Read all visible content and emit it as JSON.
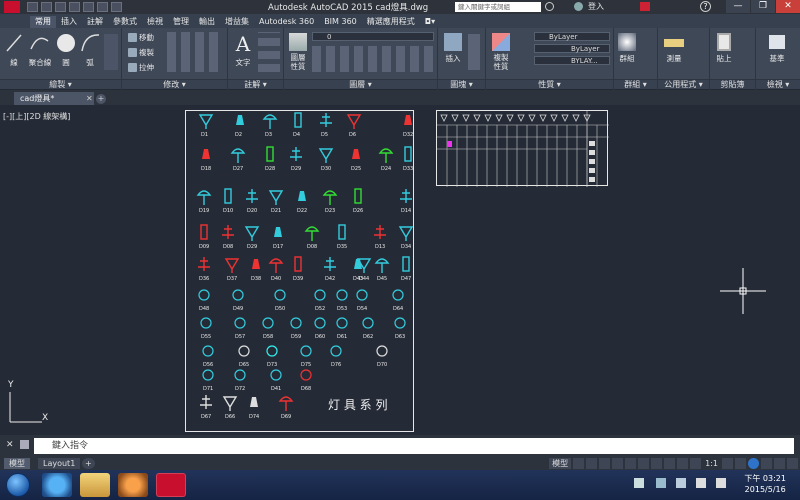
{
  "window": {
    "title": "Autodesk AutoCAD 2015   cad燈具.dwg",
    "search_placeholder": "鍵入關鍵字或詞組",
    "login": "登入",
    "controls": [
      "—",
      "❐",
      "✕"
    ]
  },
  "menu_tabs": [
    "常用",
    "插入",
    "註解",
    "參數式",
    "檢視",
    "管理",
    "輸出",
    "增益集",
    "Autodesk 360",
    "BIM 360",
    "精選應用程式",
    "◘▾"
  ],
  "ribbon": {
    "draw": {
      "label": "繪製 ▾",
      "line": "線",
      "polyline": "聚合線",
      "circle": "圓",
      "arc": "弧"
    },
    "modify": {
      "label": "修改 ▾",
      "move": "移動",
      "copy": "複製",
      "stretch": "拉伸"
    },
    "annotation": {
      "label": "註解 ▾",
      "text": "文字"
    },
    "layers": {
      "label": "圖層 ▾",
      "layer_props": "圖層\n性質",
      "current_layer": "0"
    },
    "block": {
      "label": "圖塊 ▾",
      "insert": "插入"
    },
    "properties": {
      "label": "性質 ▾",
      "match": "複製\n性質",
      "color": "ByLayer",
      "linetype": "ByLayer",
      "lineweight": "BYLAY..."
    },
    "groups": {
      "label": "群組 ▾",
      "group": "群組"
    },
    "utilities": {
      "label": "公用程式 ▾",
      "measure": "測量"
    },
    "clipboard": {
      "label": "剪貼簿",
      "paste": "貼上"
    },
    "view": {
      "label": "檢視 ▾",
      "base": "基準"
    }
  },
  "doc_tab": "cad燈具*",
  "viewport_label": "[-][上][2D 線架構]",
  "ucs": {
    "x": "X",
    "y": "Y"
  },
  "command": {
    "placeholder": "鍵入指令"
  },
  "layout_tabs": [
    "模型",
    "Layout1"
  ],
  "status": {
    "model": "模型",
    "scale": "1:1"
  },
  "taskbar": {
    "time": "下午 03:21",
    "date": "2015/5/16"
  },
  "drawing": {
    "title": "灯 具 系 列",
    "labels": [
      {
        "t": "D1"
      },
      {
        "t": "D2"
      },
      {
        "t": "D3"
      },
      {
        "t": "D4"
      },
      {
        "t": "D5"
      },
      {
        "t": "D6"
      },
      {
        "t": "D32"
      },
      {
        "t": "D18"
      },
      {
        "t": "D27"
      },
      {
        "t": "D28"
      },
      {
        "t": "D29"
      },
      {
        "t": "D30"
      },
      {
        "t": "D25"
      },
      {
        "t": "D24"
      },
      {
        "t": "D33"
      },
      {
        "t": "D19"
      },
      {
        "t": "D10"
      },
      {
        "t": "D20"
      },
      {
        "t": "D21"
      },
      {
        "t": "D22"
      },
      {
        "t": "D23"
      },
      {
        "t": "D26"
      },
      {
        "t": "D14"
      },
      {
        "t": "D09"
      },
      {
        "t": "D08"
      },
      {
        "t": "D29"
      },
      {
        "t": "D17"
      },
      {
        "t": "D08"
      },
      {
        "t": "D35"
      },
      {
        "t": "D13"
      },
      {
        "t": "D34"
      },
      {
        "t": "D36"
      },
      {
        "t": "D37"
      },
      {
        "t": "D38"
      },
      {
        "t": "D40"
      },
      {
        "t": "D39"
      },
      {
        "t": "D42"
      },
      {
        "t": "D44"
      },
      {
        "t": "D43"
      },
      {
        "t": "D45"
      },
      {
        "t": "D47"
      },
      {
        "t": "D48"
      },
      {
        "t": "D49"
      },
      {
        "t": "D50"
      },
      {
        "t": "D52"
      },
      {
        "t": "D53"
      },
      {
        "t": "D54"
      },
      {
        "t": "D64"
      },
      {
        "t": "D55"
      },
      {
        "t": "D57"
      },
      {
        "t": "D58"
      },
      {
        "t": "D59"
      },
      {
        "t": "D60"
      },
      {
        "t": "D61"
      },
      {
        "t": "D62"
      },
      {
        "t": "D63"
      },
      {
        "t": "D56"
      },
      {
        "t": "D65"
      },
      {
        "t": "D73"
      },
      {
        "t": "D75"
      },
      {
        "t": "D76"
      },
      {
        "t": "D70"
      },
      {
        "t": "D71"
      },
      {
        "t": "D72"
      },
      {
        "t": "D41"
      },
      {
        "t": "D68"
      },
      {
        "t": "D67"
      },
      {
        "t": "D66"
      },
      {
        "t": "D74"
      },
      {
        "t": "D69"
      }
    ]
  }
}
